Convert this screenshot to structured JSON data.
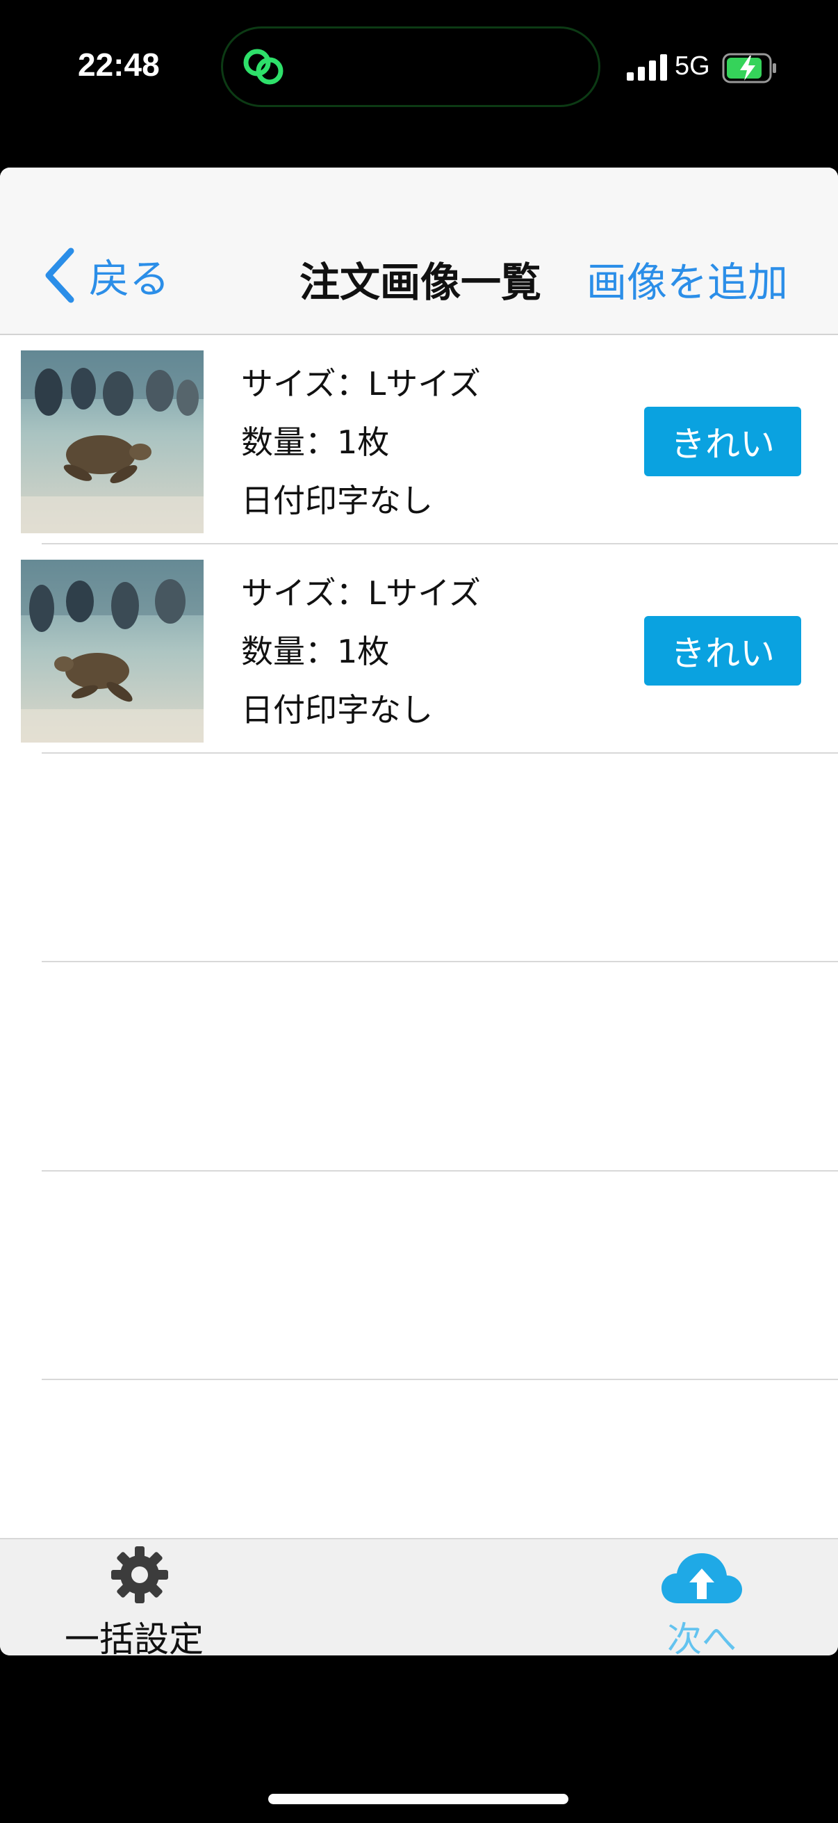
{
  "status_bar": {
    "time": "22:48",
    "network": "5G",
    "island_icon": "link-rings-icon",
    "battery_state": "charging"
  },
  "nav": {
    "back_label": "戻る",
    "title": "注文画像一覧",
    "add_label": "画像を追加"
  },
  "items": [
    {
      "size": "サイズ：Lサイズ",
      "quantity": "数量：1枚",
      "date_print": "日付印字なし",
      "quality_button": "きれい",
      "thumbnail": "sea-turtle-photo"
    },
    {
      "size": "サイズ：Lサイズ",
      "quantity": "数量：1枚",
      "date_print": "日付印字なし",
      "quality_button": "きれい",
      "thumbnail": "sea-turtle-photo"
    }
  ],
  "toolbar": {
    "bulk_settings_label": "一括設定",
    "next_label": "次へ"
  },
  "colors": {
    "accent_blue": "#2b8ee8",
    "button_blue": "#0aa2e0",
    "next_blue": "#63c3ef"
  }
}
